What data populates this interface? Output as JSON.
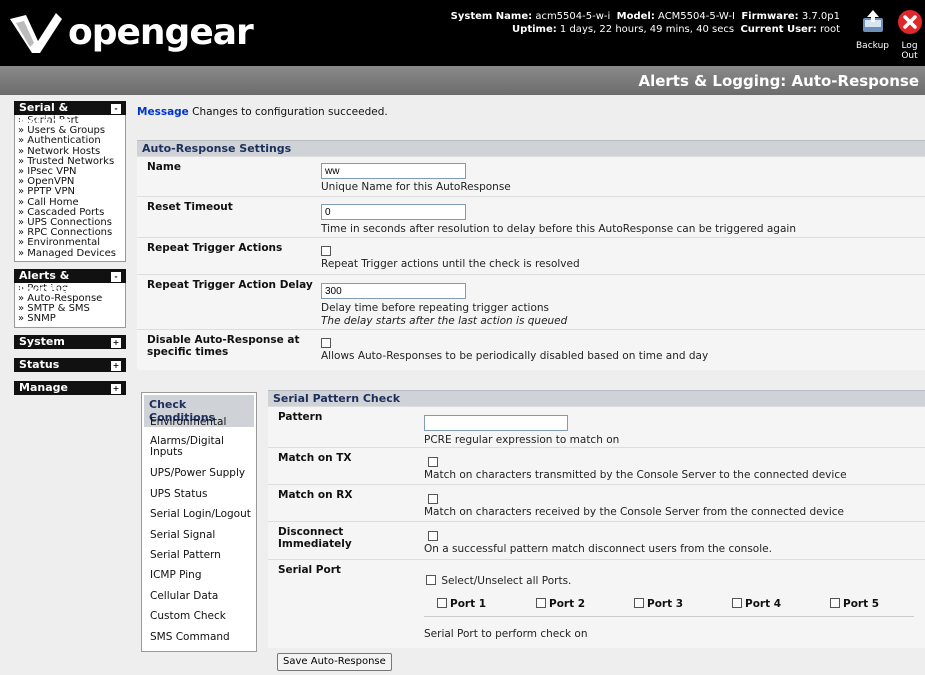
{
  "header": {
    "logo_text": "opengear",
    "system_name_label": "System Name:",
    "system_name": "acm5504-5-w-i",
    "model_label": "Model:",
    "model": "ACM5504-5-W-I",
    "firmware_label": "Firmware:",
    "firmware": "3.7.0p1",
    "uptime_label": "Uptime:",
    "uptime": "1 days, 22 hours, 49 mins, 40 secs",
    "current_user_label": "Current User:",
    "current_user": "root",
    "backup_label": "Backup",
    "logout_label": "Log Out"
  },
  "page_title": "Alerts & Logging: Auto-Response",
  "sidebar": {
    "serial_network": {
      "title": "Serial & Network",
      "items": [
        "» Serial Port",
        "» Users & Groups",
        "» Authentication",
        "» Network Hosts",
        "» Trusted Networks",
        "» IPsec VPN",
        "» OpenVPN",
        "» PPTP VPN",
        "» Call Home",
        "» Cascaded Ports",
        "» UPS Connections",
        "» RPC Connections",
        "» Environmental",
        "» Managed Devices"
      ]
    },
    "alerts_logging": {
      "title": "Alerts & Logging",
      "items": [
        "» Port Log",
        "» Auto-Response",
        "» SMTP & SMS",
        "» SNMP"
      ]
    },
    "system": {
      "title": "System"
    },
    "status": {
      "title": "Status"
    },
    "manage": {
      "title": "Manage"
    }
  },
  "message": {
    "label": "Message",
    "text": "Changes to configuration succeeded."
  },
  "settings": {
    "title": "Auto-Response Settings",
    "name": {
      "label": "Name",
      "value": "ww",
      "hint": "Unique Name for this AutoResponse"
    },
    "reset_timeout": {
      "label": "Reset Timeout",
      "value": "0",
      "hint": "Time in seconds after resolution to delay before this AutoResponse can be triggered again"
    },
    "repeat_trigger": {
      "label": "Repeat Trigger Actions",
      "hint": "Repeat Trigger actions until the check is resolved",
      "checked": false
    },
    "repeat_delay": {
      "label": "Repeat Trigger Action Delay",
      "value": "300",
      "hint": "Delay time before repeating trigger actions",
      "hint2": "The delay starts after the last action is queued"
    },
    "disable_times": {
      "label_line1": "Disable Auto-Response at",
      "label_line2": "specific times",
      "hint": "Allows Auto-Responses to be periodically disabled based on time and day",
      "checked": false
    }
  },
  "check_conditions": {
    "title": "Check Conditions",
    "items": [
      "Environmental",
      "Alarms/Digital",
      "Inputs",
      "UPS/Power Supply",
      "UPS Status",
      "Serial Login/Logout",
      "Serial Signal",
      "Serial Pattern",
      "ICMP Ping",
      "Cellular Data",
      "Custom Check",
      "SMS Command"
    ]
  },
  "serial_pattern": {
    "title": "Serial Pattern Check",
    "pattern": {
      "label": "Pattern",
      "value": "",
      "hint": "PCRE regular expression to match on"
    },
    "match_tx": {
      "label": "Match on TX",
      "hint": "Match on characters transmitted by the Console Server to the connected device",
      "checked": false
    },
    "match_rx": {
      "label": "Match on RX",
      "hint": "Match on characters received by the Console Server from the connected device",
      "checked": false
    },
    "disconnect": {
      "label_line1": "Disconnect",
      "label_line2": "Immediately",
      "hint": "On a successful pattern match disconnect users from the console.",
      "checked": false
    },
    "serial_port": {
      "label": "Serial Port",
      "select_all": "Select/Unselect all Ports.",
      "ports": [
        "Port 1",
        "Port 2",
        "Port 3",
        "Port 4",
        "Port 5"
      ],
      "hint": "Serial Port to perform check on"
    }
  },
  "save_button": "Save Auto-Response",
  "colors": {
    "header_bg": "#000000",
    "section_head": "#cfd3d8",
    "section_head_text": "#1d2e5c",
    "message_label": "#0033cc",
    "logout_red": "#e0282a"
  }
}
